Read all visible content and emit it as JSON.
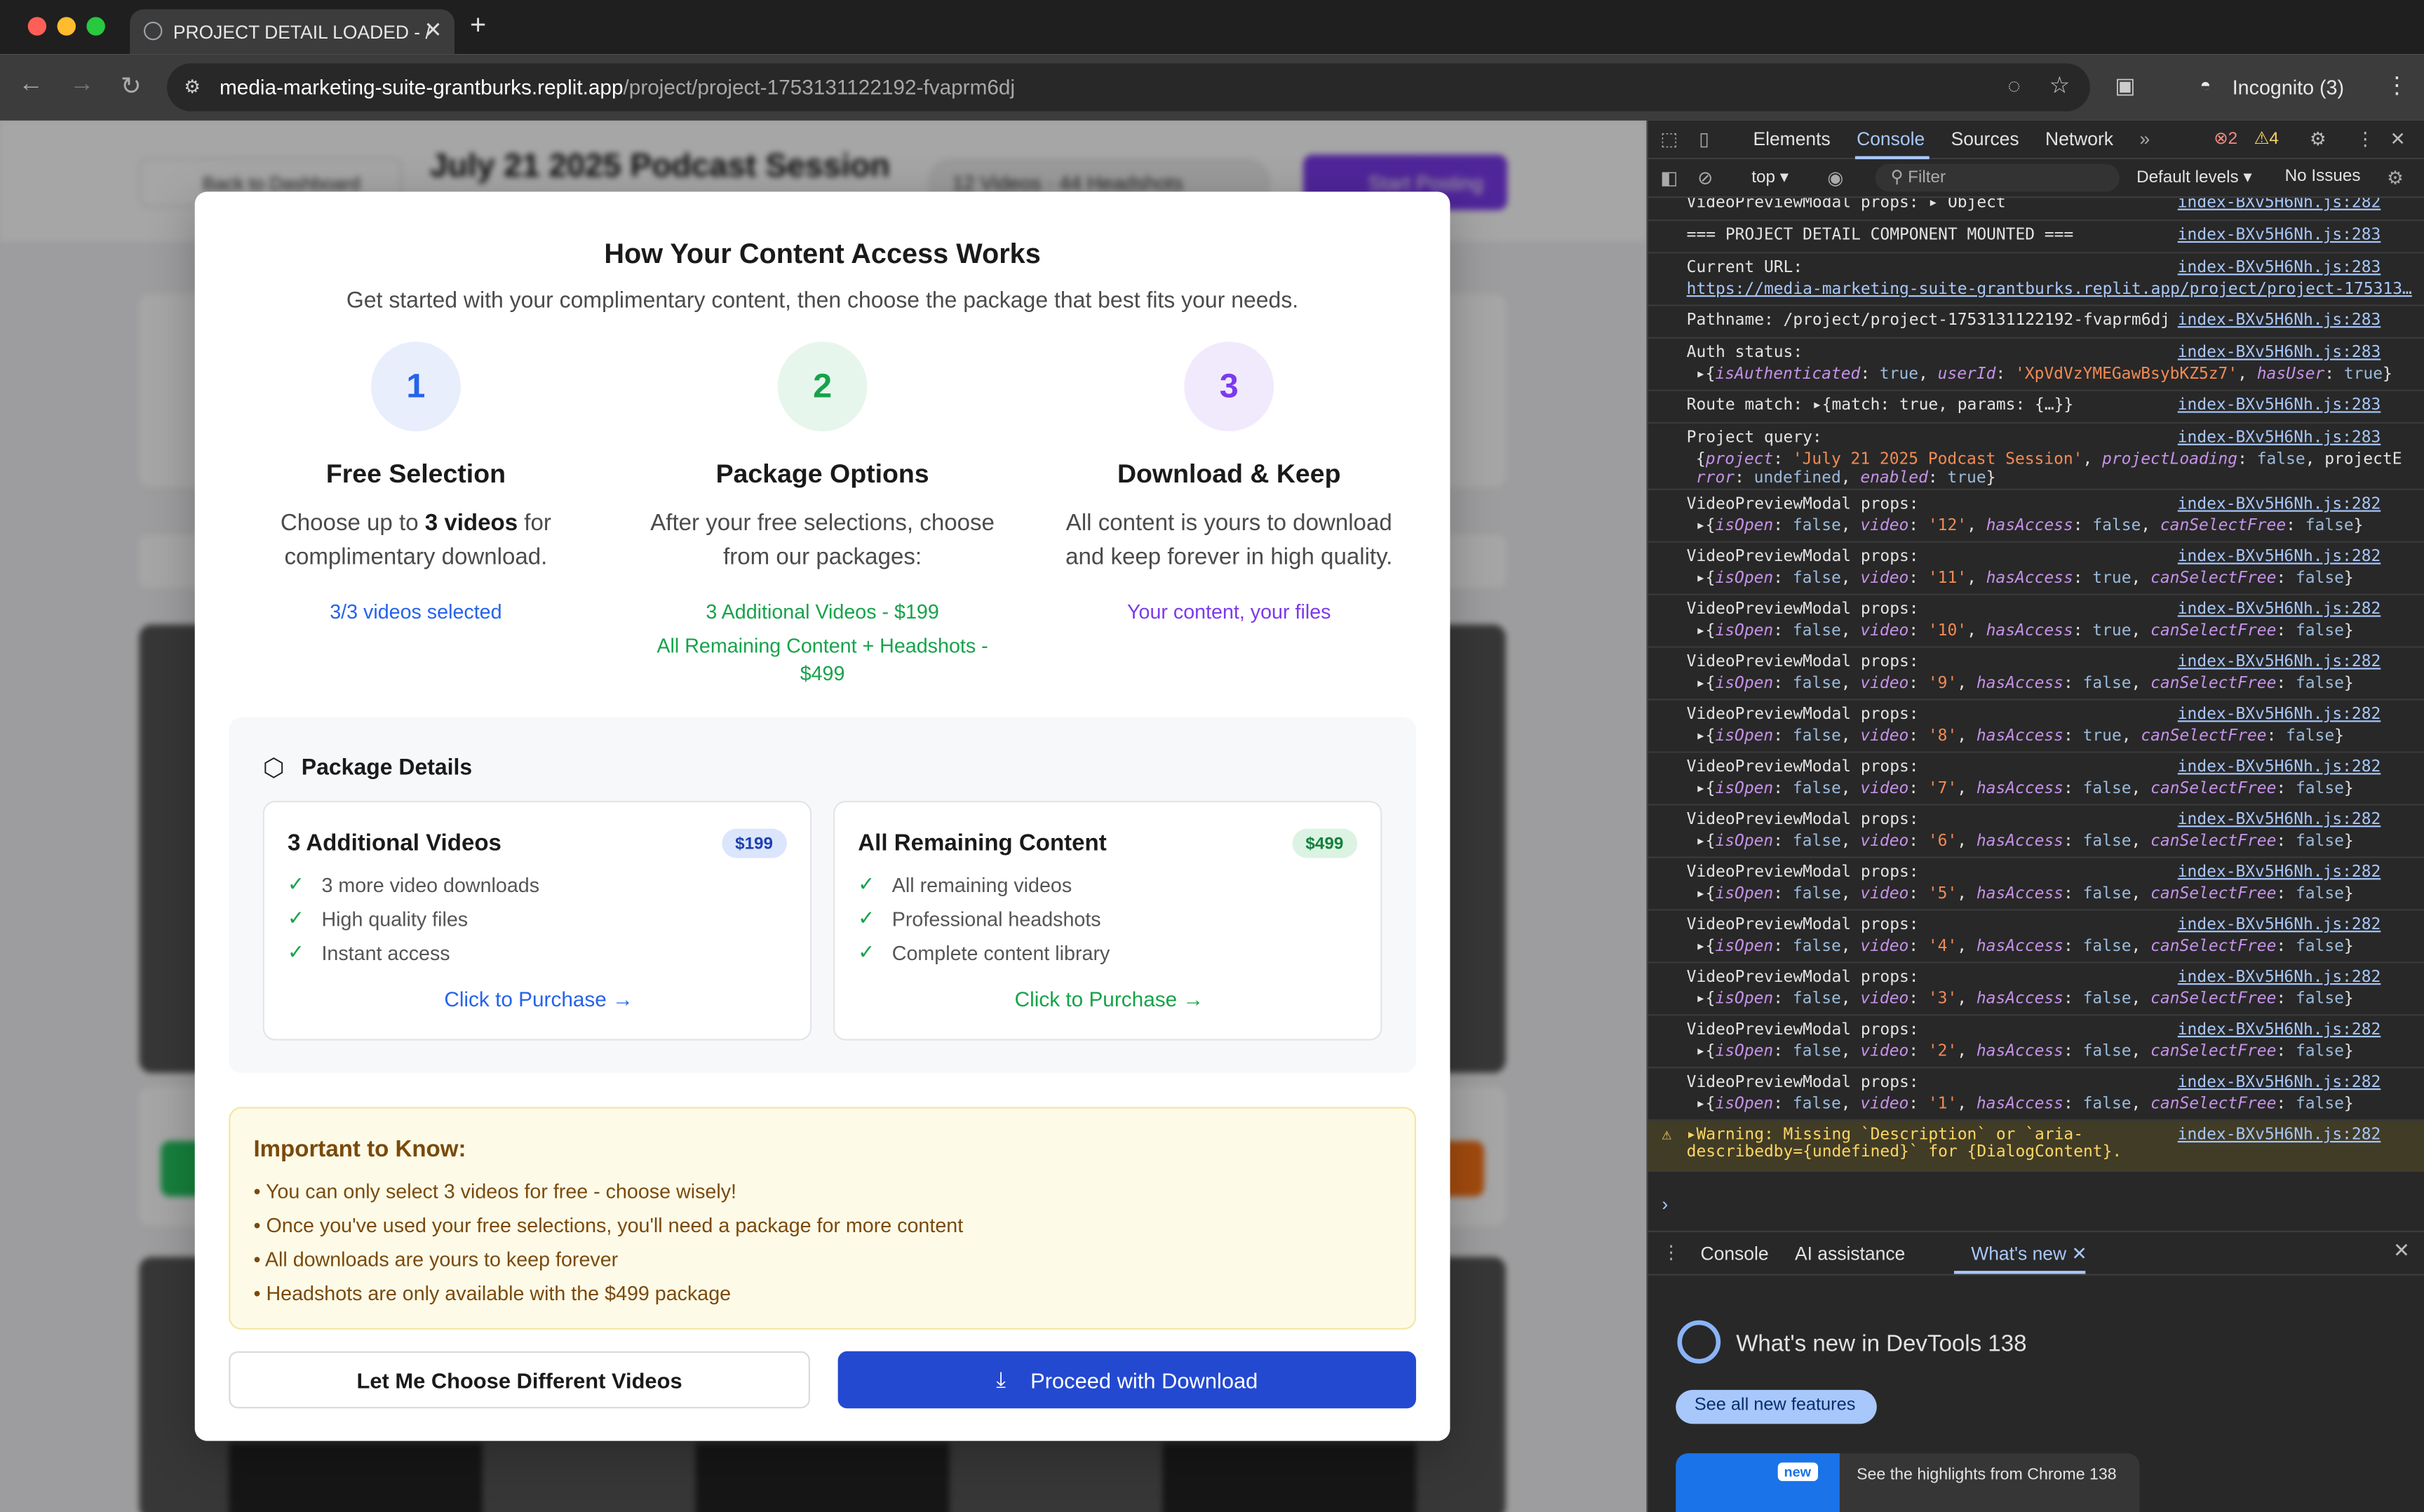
{
  "browser": {
    "tab_title": "PROJECT DETAIL LOADED - /",
    "url_host": "media-marketing-suite-grantburks.replit.app",
    "url_path": "/project/project-1753131122192-fvaprm6dj",
    "incognito_label": "Incognito (3)"
  },
  "background_page": {
    "back_label": "Back to Dashboard",
    "title": "July 21 2025 Podcast Session",
    "stats": "12 Videos · 44 Headshots",
    "action": "Start Posting"
  },
  "modal": {
    "title": "How Your Content Access Works",
    "subtitle": "Get started with your complimentary content, then choose the package that best fits your needs.",
    "steps": [
      {
        "num": "1",
        "title": "Free Selection",
        "desc_pre": "Choose up to ",
        "desc_bold": "3 videos",
        "desc_post": " for complimentary download.",
        "note": "3/3 videos selected",
        "color": "#2563eb",
        "bg": "#e8eefc"
      },
      {
        "num": "2",
        "title": "Package Options",
        "desc": "After your free selections, choose from our packages:",
        "note1": "3 Additional Videos - $199",
        "note2": "All Remaining Content + Headshots - $499",
        "color": "#16a34a",
        "bg": "#e7f6ec"
      },
      {
        "num": "3",
        "title": "Download & Keep",
        "desc": "All content is yours to download and keep forever in high quality.",
        "note": "Your content, your files",
        "color": "#7c3aed",
        "bg": "#f1eafd"
      }
    ],
    "package_details_title": "Package Details",
    "packages": [
      {
        "name": "3 Additional Videos",
        "price": "$199",
        "features": [
          "3 more video downloads",
          "High quality files",
          "Instant access"
        ],
        "cta": "Click to Purchase →"
      },
      {
        "name": "All Remaining Content",
        "price": "$499",
        "features": [
          "All remaining videos",
          "Professional headshots",
          "Complete content library"
        ],
        "cta": "Click to Purchase →"
      }
    ],
    "important_title": "Important to Know:",
    "important_items": [
      "• You can only select 3 videos for free - choose wisely!",
      "• Once you've used your free selections, you'll need a package for more content",
      "• All downloads are yours to keep forever",
      "• Headshots are only available with the $499 package"
    ],
    "btn_choose": "Let Me Choose Different Videos",
    "btn_proceed": "Proceed with Download"
  },
  "devtools": {
    "tabs": [
      "Elements",
      "Console",
      "Sources",
      "Network"
    ],
    "errors": "2",
    "warnings": "4",
    "context": "top",
    "filter_placeholder": "Filter",
    "levels": "Default levels ▾",
    "issues": "No Issues",
    "drawer_tabs": [
      "Console",
      "AI assistance",
      "What's new"
    ],
    "whats_new_title": "What's new in DevTools 138",
    "see_all": "See all new features",
    "highlights": "See the highlights from Chrome 138",
    "new_badge": "new",
    "logs": [
      {
        "l1": "VideoPreviewModal props:  ▸ Object",
        "src": "index-BXv5H6Nh.js:282"
      },
      {
        "l1": "=== PROJECT DETAIL COMPONENT MOUNTED ===",
        "src": "index-BXv5H6Nh.js:283"
      },
      {
        "l1": "Current URL:",
        "l2": "https://media-marketing-suite-grantburks.replit.app/project/project-175313…",
        "src": "index-BXv5H6Nh.js:283"
      },
      {
        "l1": "Pathname: /project/project-1753131122192-fvaprm6dj",
        "src": "index-BXv5H6Nh.js:283"
      },
      {
        "l1": "Auth status:",
        "l2": "▸{isAuthenticated: true, userId: 'XpVdVzYMEGawBsybKZ5z7', hasUser: true}",
        "src": "index-BXv5H6Nh.js:283"
      },
      {
        "l1": "Route match:  ▸{match: true, params: {…}}",
        "src": "index-BXv5H6Nh.js:283"
      },
      {
        "l1": "Project query:",
        "l2": "{project: 'July 21 2025 Podcast Session', projectLoading: false, projectE",
        "l3": "rror: undefined, enabled: true}",
        "src": "index-BXv5H6Nh.js:283"
      },
      {
        "l1": "VideoPreviewModal props:",
        "l2": "▸{isOpen: false, video: '12', hasAccess: false, canSelectFree: false}",
        "src": "index-BXv5H6Nh.js:282"
      },
      {
        "l1": "VideoPreviewModal props:",
        "l2": "▸{isOpen: false, video: '11', hasAccess: true, canSelectFree: false}",
        "src": "index-BXv5H6Nh.js:282"
      },
      {
        "l1": "VideoPreviewModal props:",
        "l2": "▸{isOpen: false, video: '10', hasAccess: true, canSelectFree: false}",
        "src": "index-BXv5H6Nh.js:282"
      },
      {
        "l1": "VideoPreviewModal props:",
        "l2": "▸{isOpen: false, video: '9', hasAccess: false, canSelectFree: false}",
        "src": "index-BXv5H6Nh.js:282"
      },
      {
        "l1": "VideoPreviewModal props:",
        "l2": "▸{isOpen: false, video: '8', hasAccess: true, canSelectFree: false}",
        "src": "index-BXv5H6Nh.js:282"
      },
      {
        "l1": "VideoPreviewModal props:",
        "l2": "▸{isOpen: false, video: '7', hasAccess: false, canSelectFree: false}",
        "src": "index-BXv5H6Nh.js:282"
      },
      {
        "l1": "VideoPreviewModal props:",
        "l2": "▸{isOpen: false, video: '6', hasAccess: false, canSelectFree: false}",
        "src": "index-BXv5H6Nh.js:282"
      },
      {
        "l1": "VideoPreviewModal props:",
        "l2": "▸{isOpen: false, video: '5', hasAccess: false, canSelectFree: false}",
        "src": "index-BXv5H6Nh.js:282"
      },
      {
        "l1": "VideoPreviewModal props:",
        "l2": "▸{isOpen: false, video: '4', hasAccess: false, canSelectFree: false}",
        "src": "index-BXv5H6Nh.js:282"
      },
      {
        "l1": "VideoPreviewModal props:",
        "l2": "▸{isOpen: false, video: '3', hasAccess: false, canSelectFree: false}",
        "src": "index-BXv5H6Nh.js:282"
      },
      {
        "l1": "VideoPreviewModal props:",
        "l2": "▸{isOpen: false, video: '2', hasAccess: false, canSelectFree: false}",
        "src": "index-BXv5H6Nh.js:282"
      },
      {
        "l1": "VideoPreviewModal props:",
        "l2": "▸{isOpen: false, video: '1', hasAccess: false, canSelectFree: false}",
        "src": "index-BXv5H6Nh.js:282"
      }
    ],
    "warning_l1": "▸Warning: Missing `Description` or `aria-",
    "warning_l2": "describedby={undefined}` for {DialogContent}.",
    "warning_src": "index-BXv5H6Nh.js:282"
  }
}
